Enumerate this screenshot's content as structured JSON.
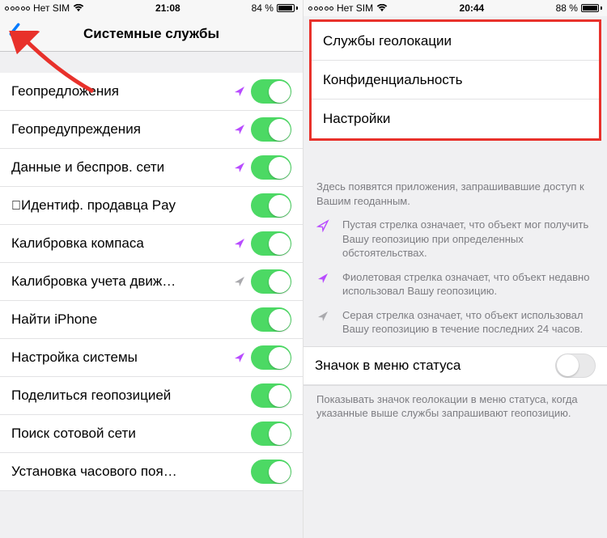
{
  "left": {
    "status": {
      "carrier": "Нет SIM",
      "time": "21:08",
      "battery_pct": "84 %"
    },
    "nav": {
      "title": "Системные службы"
    },
    "rows": [
      {
        "label": "Геопредложения",
        "icon": "solid-purple"
      },
      {
        "label": "Геопредупреждения",
        "icon": "solid-purple"
      },
      {
        "label": "Данные и беспров. сети",
        "icon": "solid-purple"
      },
      {
        "label": "Идентиф. продавца Pay",
        "icon": "none",
        "apple": true
      },
      {
        "label": "Калибровка компаса",
        "icon": "solid-purple"
      },
      {
        "label": "Калибровка учета движ…",
        "icon": "solid-gray"
      },
      {
        "label": "Найти iPhone",
        "icon": "none"
      },
      {
        "label": "Настройка системы",
        "icon": "solid-purple"
      },
      {
        "label": "Поделиться геопозицией",
        "icon": "none"
      },
      {
        "label": "Поиск сотовой сети",
        "icon": "none"
      },
      {
        "label": "Установка часового поя…",
        "icon": "none"
      }
    ]
  },
  "right": {
    "status": {
      "carrier": "Нет SIM",
      "time": "20:44",
      "battery_pct": "88 %"
    },
    "crumbs": [
      "Службы геолокации",
      "Конфиденциальность",
      "Настройки"
    ],
    "desc_intro": "Здесь появятся приложения, запрашивавшие доступ к Вашим геоданным.",
    "legend": [
      {
        "icon": "hollow-purple",
        "text": "Пустая стрелка означает, что объект мог получить Вашу геопозицию при определенных обстоятельствах."
      },
      {
        "icon": "solid-purple",
        "text": "Фиолетовая стрелка означает, что объект недавно использовал Вашу геопозицию."
      },
      {
        "icon": "solid-gray",
        "text": "Серая стрелка означает, что объект использовал Вашу геопозицию в течение последних 24 часов."
      }
    ],
    "status_icon_row": {
      "label": "Значок в меню статуса"
    },
    "status_icon_desc": "Показывать значок геолокации в меню статуса, когда указанные выше службы запрашивают геопозицию."
  }
}
